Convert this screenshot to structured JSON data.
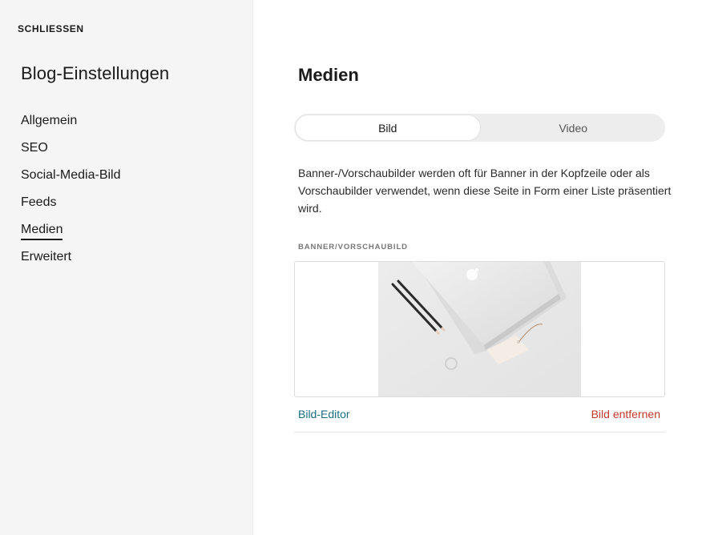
{
  "sidebar": {
    "close_label": "SCHLIESSEN",
    "title": "Blog-Einstellungen",
    "items": [
      {
        "label": "Allgemein",
        "active": false
      },
      {
        "label": "SEO",
        "active": false
      },
      {
        "label": "Social-Media-Bild",
        "active": false
      },
      {
        "label": "Feeds",
        "active": false
      },
      {
        "label": "Medien",
        "active": true
      },
      {
        "label": "Erweitert",
        "active": false
      }
    ]
  },
  "main": {
    "title": "Medien",
    "tabs": [
      {
        "label": "Bild",
        "active": true
      },
      {
        "label": "Video",
        "active": false
      }
    ],
    "description": "Banner-/Vorschaubilder werden oft für Banner in der Kopfzeile oder als Vorschaubilder verwendet, wenn diese Seite in Form einer Liste präsentiert wird.",
    "field_label": "BANNER/VORSCHAUBILD",
    "image_editor_label": "Bild-Editor",
    "remove_image_label": "Bild entfernen"
  },
  "colors": {
    "sidebar_bg": "#f5f5f5",
    "link_teal": "#1a6f7e",
    "link_red": "#c0392b"
  }
}
